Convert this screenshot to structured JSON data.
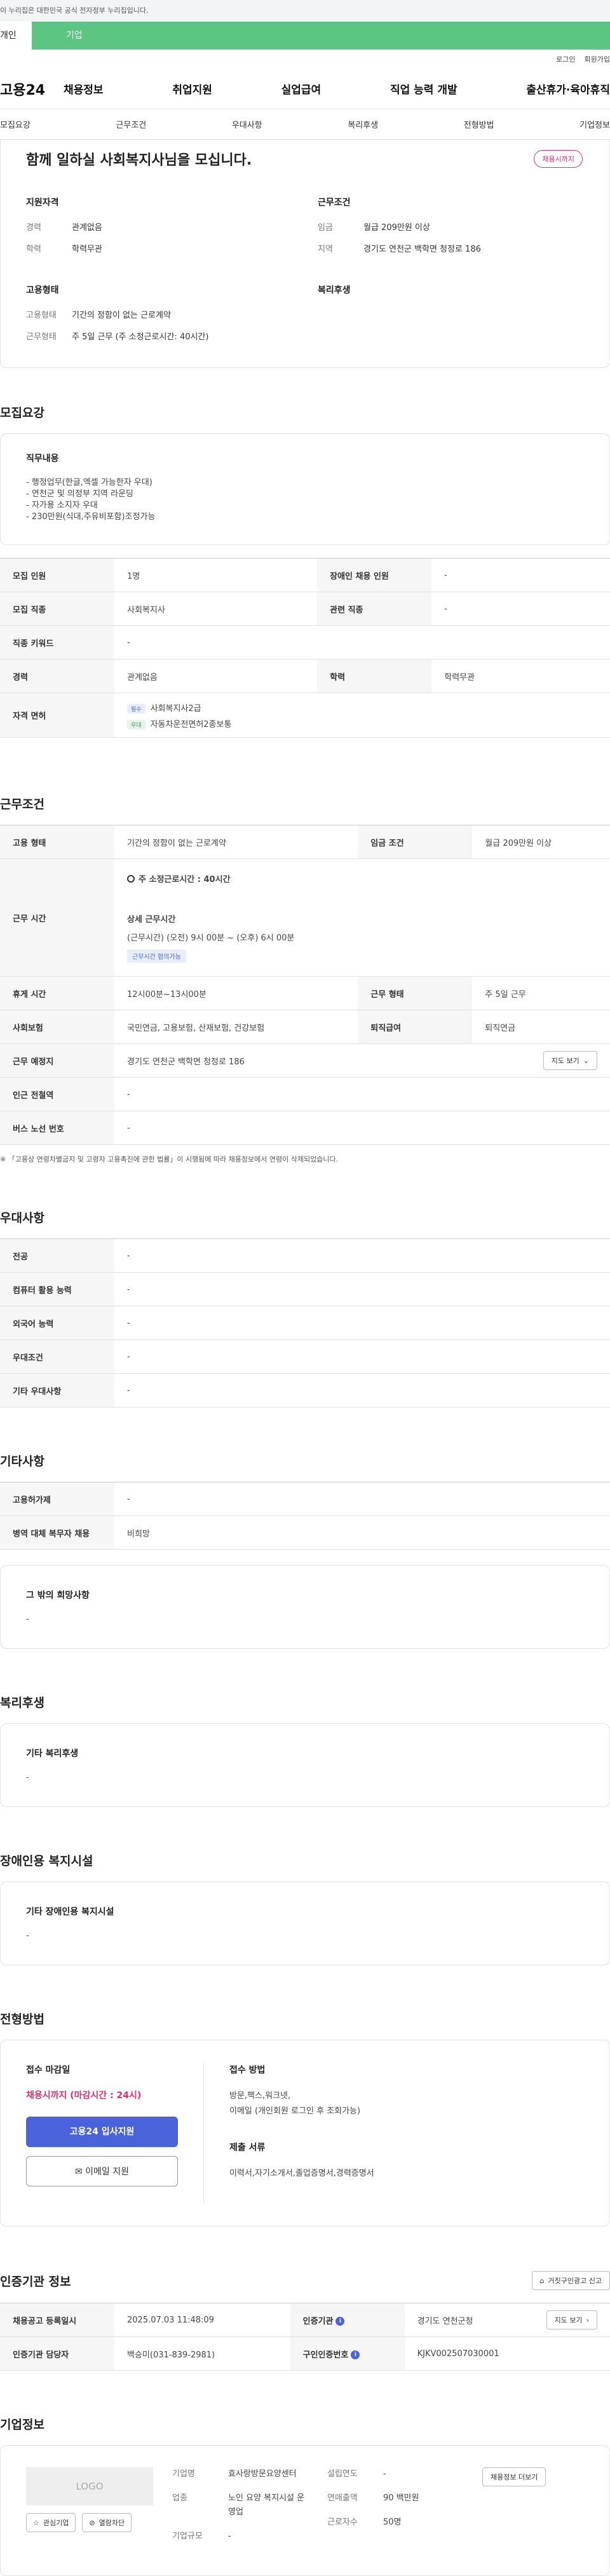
{
  "notice": "이 누리집은 대한민국 공식 전자정부 누리집입니다.",
  "user_tabs": {
    "personal": "개인",
    "company": "기업"
  },
  "util": {
    "login": "로그인",
    "join": "회원가입"
  },
  "logo": "고용24",
  "gnb": [
    "채용정보",
    "취업지원",
    "실업급여",
    "직업 능력 개발",
    "출산휴가·육아휴직"
  ],
  "anchor_tabs": [
    "모집요강",
    "근무조건",
    "우대사항",
    "복리후생",
    "전형방법",
    "기업정보"
  ],
  "summary": {
    "title": "함께 일하실 사회복지사님을 모십니다.",
    "badge": "채용시까지",
    "qual": {
      "title": "지원자격",
      "rows": [
        {
          "k": "경력",
          "v": "관계없음"
        },
        {
          "k": "학력",
          "v": "학력무관"
        }
      ]
    },
    "cond": {
      "title": "근무조건",
      "rows": [
        {
          "k": "임금",
          "v": "월급 209만원 이상"
        },
        {
          "k": "지역",
          "v": "경기도 연천군 백학면 청정로 186"
        }
      ]
    },
    "emp": {
      "title": "고용형태",
      "rows": [
        {
          "k": "고용형태",
          "v": "기간의 정함이 없는 근로계약"
        },
        {
          "k": "근무형태",
          "v": "주 5일 근무 (주 소정근로시간: 40시간)"
        }
      ]
    },
    "welfare": {
      "title": "복리후생"
    }
  },
  "recruit": {
    "title": "모집요강",
    "duty_title": "직무내용",
    "duty_lines": [
      "- 행정업무(한글,엑셀 가능한자 우대)",
      "- 연천군 및 의정부 지역  라운딩",
      "- 자가용 소지자 우대",
      "- 230만원(식대,주유비포함)조정가능"
    ],
    "rows": {
      "count_k": "모집 인원",
      "count_v": "1명",
      "disabled_k": "장애인 채용 인원",
      "disabled_v": "-",
      "job_k": "모집 직종",
      "job_v": "사회복지사",
      "rel_k": "관련 직종",
      "rel_v": "-",
      "kw_k": "직종 키워드",
      "kw_v": "-",
      "career_k": "경력",
      "career_v": "관계없음",
      "edu_k": "학력",
      "edu_v": "학력무관",
      "lic_k": "자격 면허",
      "lic1_tag": "필수",
      "lic1": "사회복지사2급",
      "lic2_tag": "우대",
      "lic2": "자동차운전면허2종보통"
    }
  },
  "work": {
    "title": "근무조건",
    "emp_k": "고용 형태",
    "emp_v": "기간의 정함이 없는 근로계약",
    "wage_k": "임금 조건",
    "wage_v": "월급 209만원 이상",
    "hours_k": "근무 시간",
    "hours_week": "주 소정근로시간 : 40시간",
    "hours_detail_title": "상세 근무시간",
    "hours_detail": "(근무시간) (오전) 9시 00분 ~ (오후) 6시 00분",
    "hours_tag": "근무시간 협의가능",
    "break_k": "휴게 시간",
    "break_v": "12시00분~13시00분",
    "shift_k": "근무 형태",
    "shift_v": "주 5일 근무",
    "ins_k": "사회보험",
    "ins_v": "국민연금, 고용보험, 산재보험, 건강보험",
    "sev_k": "퇴직급여",
    "sev_v": "퇴직연금",
    "place_k": "근무 예정지",
    "place_v": "경기도 연천군 백학면 청정로 186",
    "map_btn": "지도 보기",
    "subway_k": "인근 전철역",
    "subway_v": "-",
    "bus_k": "버스 노선 번호",
    "bus_v": "-",
    "footnote": "※ 「고용상 연령차별금지 및 고령자 고용촉진에 관한 법률」이 시행됨에 따라 채용정보에서 연령이 삭제되었습니다."
  },
  "pref": {
    "title": "우대사항",
    "rows": [
      {
        "k": "전공",
        "v": "-"
      },
      {
        "k": "컴퓨터 활용 능력",
        "v": "-"
      },
      {
        "k": "외국어 능력",
        "v": "-"
      },
      {
        "k": "우대조건",
        "v": "-"
      },
      {
        "k": "기타 우대사항",
        "v": "-"
      }
    ]
  },
  "etc": {
    "title": "기타사항",
    "rows": [
      {
        "k": "고용허가제",
        "v": "-"
      },
      {
        "k": "병역 대체 복무자 채용",
        "v": "비희망"
      }
    ],
    "other_title": "그 밖의 희망사항",
    "other_v": "-"
  },
  "welfare": {
    "title": "복리후생",
    "box_title": "기타 복리후생",
    "box_v": "-"
  },
  "disabled_fac": {
    "title": "장애인용 복지시설",
    "box_title": "기타 장애인용 복지시설",
    "box_v": "-"
  },
  "apply": {
    "title": "전형방법",
    "deadline_title": "접수 마감일",
    "deadline": "채용시까지 (마감시간 : 24시)",
    "btn_apply": "고용24 입사지원",
    "btn_email": "이메일 지원",
    "method_title": "접수 방법",
    "method": "방문,팩스,워크넷,",
    "method2": "이메일 (개인회원 로그인 후 조회가능)",
    "docs_title": "제출 서류",
    "docs": "이력서,자기소개서,졸업증명서,경력증명서"
  },
  "agency": {
    "title": "인증기관 정보",
    "report_btn": "거짓구인광고 신고",
    "reg_k": "채용공고 등록일시",
    "reg_v": "2025.07.03 11:48:09",
    "org_k": "인증기관",
    "org_v": "경기도 연천군청",
    "map_btn": "지도 보기",
    "mgr_k": "인증기관 담당자",
    "mgr_v": "백승미(031-839-2981)",
    "num_k": "구인인증번호",
    "num_v": "KJKV002507030001"
  },
  "company": {
    "title": "기업정보",
    "logo": "LOGO",
    "btn_fav": "관심기업",
    "btn_block": "열람차단",
    "name_k": "기업명",
    "name_v": "효사랑방문요양센터",
    "ind_k": "업종",
    "ind_v": "노인 요양 복지시설 운영업",
    "size_k": "기업규모",
    "size_v": "-",
    "year_k": "설립연도",
    "year_v": "-",
    "sales_k": "연매출액",
    "sales_v": "90 백만원",
    "emp_k": "근로자수",
    "emp_v": "50명",
    "info_btn": "채용정보 더보기"
  }
}
